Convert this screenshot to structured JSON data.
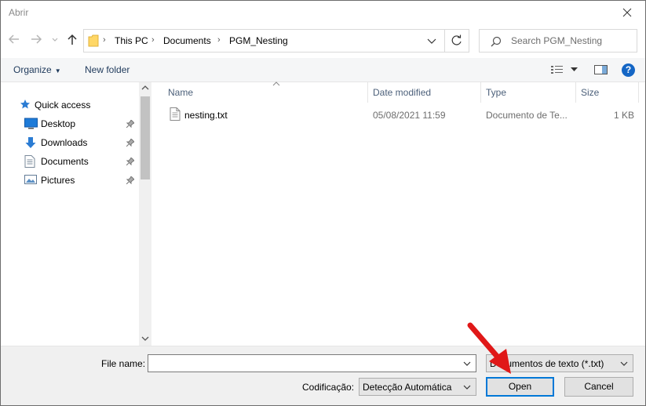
{
  "window": {
    "title": "Abrir"
  },
  "address": {
    "crumbs": [
      "This PC",
      "Documents",
      "PGM_Nesting"
    ],
    "separator": "›"
  },
  "search": {
    "placeholder": "Search PGM_Nesting"
  },
  "toolbar": {
    "organize_label": "Organize",
    "new_folder_label": "New folder",
    "help_label": "?"
  },
  "navpane": {
    "items": [
      {
        "label": "Quick access",
        "icon": "star-icon",
        "pinned": false
      },
      {
        "label": "Desktop",
        "icon": "desktop-icon",
        "pinned": true
      },
      {
        "label": "Downloads",
        "icon": "download-arrow-icon",
        "pinned": true
      },
      {
        "label": "Documents",
        "icon": "document-icon",
        "pinned": true
      },
      {
        "label": "Pictures",
        "icon": "picture-icon",
        "pinned": true
      }
    ]
  },
  "filelist": {
    "columns": [
      "Name",
      "Date modified",
      "Type",
      "Size"
    ],
    "rows": [
      {
        "name": "nesting.txt",
        "date": "05/08/2021 11:59",
        "type": "Documento de Te...",
        "size": "1 KB"
      }
    ]
  },
  "bottom": {
    "file_name_label": "File name:",
    "file_name_value": "",
    "file_type_value": "Documentos de texto (*.txt)",
    "encoding_label": "Codificação:",
    "encoding_value": "Detecção Automática",
    "open_label": "Open",
    "cancel_label": "Cancel"
  },
  "colors": {
    "accent": "#0078d7",
    "annotation": "#e01818",
    "help": "#1466c5"
  }
}
